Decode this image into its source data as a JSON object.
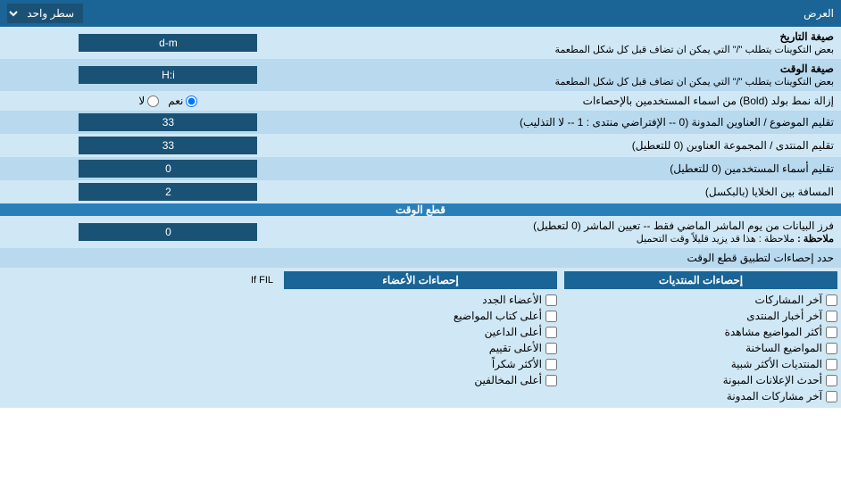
{
  "header": {
    "title": "العرض",
    "display_mode_label": "سطر واحد"
  },
  "rows": [
    {
      "id": "date_format",
      "label": "صيغة التاريخ",
      "sublabel": "بعض التكوينات يتطلب \"/\" التي يمكن ان تضاف قبل كل شكل المطعمة",
      "value": "d-m",
      "type": "input"
    },
    {
      "id": "time_format",
      "label": "صيغة الوقت",
      "sublabel": "بعض التكوينات يتطلب \"/\" التي يمكن ان تضاف قبل كل شكل المطعمة",
      "value": "H:i",
      "type": "input"
    },
    {
      "id": "bold_remove",
      "label": "إزالة نمط بولد (Bold) من اسماء المستخدمين بالإحصاءات",
      "type": "radio",
      "options": [
        "نعم",
        "لا"
      ],
      "selected": "نعم"
    },
    {
      "id": "forum_subject",
      "label": "تقليم الموضوع / العناوين المدونة (0 -- الإفتراضي منتدى : 1 -- لا التذليب)",
      "value": "33",
      "type": "input"
    },
    {
      "id": "forum_members",
      "label": "تقليم المنتدى / المجموعة العناوين (0 للتعطيل)",
      "value": "33",
      "type": "input"
    },
    {
      "id": "trim_users",
      "label": "تقليم أسماء المستخدمين (0 للتعطيل)",
      "value": "0",
      "type": "input"
    },
    {
      "id": "gap_cells",
      "label": "المسافة بين الخلايا (بالبكسل)",
      "value": "2",
      "type": "input"
    }
  ],
  "section_cutoff": {
    "title": "قطع الوقت",
    "row": {
      "label": "فرز البيانات من يوم الماشر الماضي فقط -- تعيين الماشر (0 لتعطيل)",
      "note": "ملاحظة : هذا قد يزيد قليلاً وقت التحميل",
      "value": "0"
    },
    "limit_label": "حدد إحصاءات لتطبيق قطع الوقت"
  },
  "stats_columns": {
    "col1": {
      "title": "إحصاءات المنتديات",
      "items": [
        "آخر المشاركات",
        "آخر أخبار المنتدى",
        "أكثر المواضيع مشاهدة",
        "المواضيع الساخنة",
        "المنتديات الأكثر شبية",
        "أحدث الإعلانات المبونة",
        "آخر مشاركات المدونة"
      ]
    },
    "col2": {
      "title": "إحصاءات الأعضاء",
      "items": [
        "الأعضاء الجدد",
        "أعلى كتاب المواضيع",
        "أعلى الداعين",
        "الأعلى تقييم",
        "الأكثر شكراً",
        "أعلى المخالفين"
      ]
    },
    "col3_label": "إحصاءات المنتديات",
    "col3_items": [
      "آخر المشاركات",
      "آخر أخبار المنتدى",
      "أكثر المواضيع مشاهدة",
      "المواضيع الساخنة",
      "المنتديات الأكثر شبية",
      "أحدث الإعلانات المبونة",
      "آخر مشاركات المدونة"
    ]
  },
  "footer_text": "If FIL"
}
